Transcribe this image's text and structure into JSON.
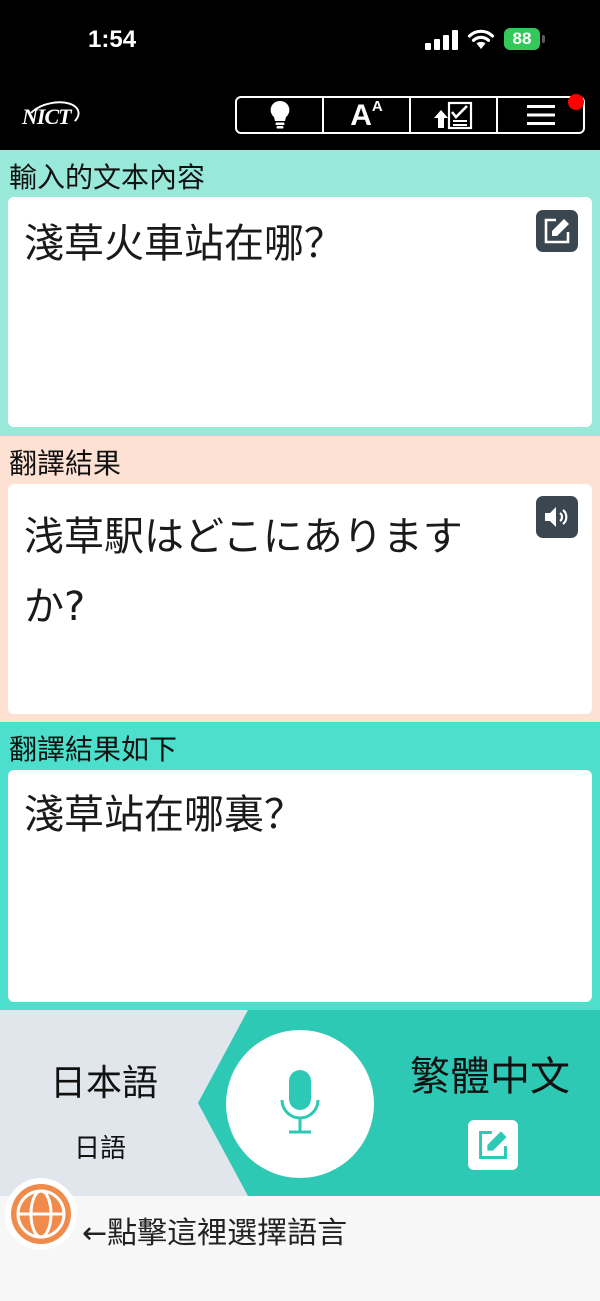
{
  "status": {
    "time": "1:54",
    "battery": "88"
  },
  "header": {
    "logo_text": "NICT",
    "tools": [
      {
        "icon": "lightbulb-icon"
      },
      {
        "icon": "font-size-icon",
        "label_big": "A",
        "label_small": "A"
      },
      {
        "icon": "upload-checklist-icon"
      },
      {
        "icon": "menu-icon"
      }
    ]
  },
  "input_section": {
    "label": "輸入的文本內容",
    "text": "淺草火車站在哪？"
  },
  "translation_section": {
    "label": "翻譯結果",
    "text": "浅草駅はどこにありますか?"
  },
  "back_translation_section": {
    "label": "翻譯結果如下",
    "text": "淺草站在哪裏？"
  },
  "language_bar": {
    "source_lang": "日本語",
    "source_lang_sub": "日語",
    "target_lang": "繁體中文"
  },
  "footer": {
    "hint": "←點擊這裡選擇語言"
  },
  "colors": {
    "input_bg": "#98e9da",
    "translation_bg": "#fde1d3",
    "back_translation_bg": "#4cdfcb",
    "accent": "#2ec9b4",
    "globe": "#f08b4b"
  }
}
